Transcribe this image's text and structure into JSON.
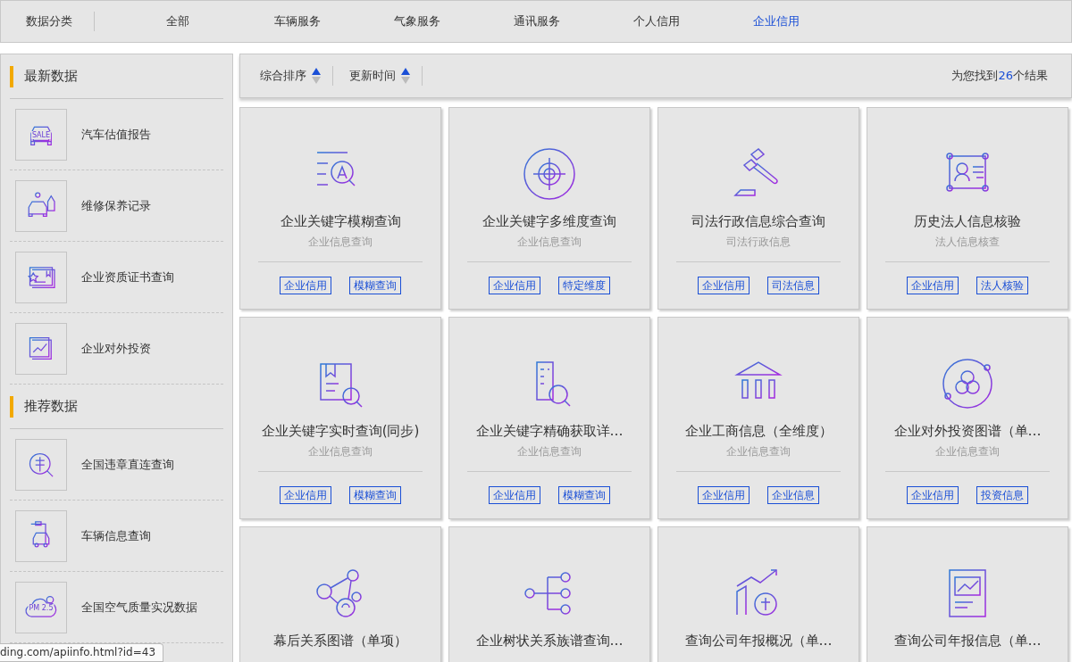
{
  "nav": {
    "label": "数据分类",
    "tabs": [
      {
        "label": "全部",
        "selected": false
      },
      {
        "label": "车辆服务",
        "selected": false
      },
      {
        "label": "气象服务",
        "selected": false
      },
      {
        "label": "通讯服务",
        "selected": false
      },
      {
        "label": "个人信用",
        "selected": false
      },
      {
        "label": "企业信用",
        "selected": true
      }
    ]
  },
  "sidebar": {
    "sections": [
      {
        "title": "最新数据",
        "items": [
          {
            "label": "汽车估值报告",
            "icon_text": "SALE"
          },
          {
            "label": "维修保养记录"
          },
          {
            "label": "企业资质证书查询"
          },
          {
            "label": "企业对外投资"
          }
        ]
      },
      {
        "title": "推荐数据",
        "items": [
          {
            "label": "全国违章直连查询"
          },
          {
            "label": "车辆信息查询"
          },
          {
            "label": "全国空气质量实况数据",
            "icon_text": "PM 2.5"
          }
        ]
      }
    ]
  },
  "toolbar": {
    "sorts": [
      "综合排序",
      "更新时间"
    ],
    "result_prefix": "为您找到",
    "result_count": "26",
    "result_suffix": "个结果"
  },
  "cards": [
    {
      "title": "企业关键字模糊查询",
      "subtitle": "企业信息查询",
      "tags": [
        "企业信用",
        "模糊查询"
      ]
    },
    {
      "title": "企业关键字多维度查询",
      "subtitle": "企业信息查询",
      "tags": [
        "企业信用",
        "特定维度"
      ]
    },
    {
      "title": "司法行政信息综合查询",
      "subtitle": "司法行政信息",
      "tags": [
        "企业信用",
        "司法信息"
      ]
    },
    {
      "title": "历史法人信息核验",
      "subtitle": "法人信息核查",
      "tags": [
        "企业信用",
        "法人核验"
      ]
    },
    {
      "title": "企业关键字实时查询(同步)",
      "subtitle": "企业信息查询",
      "tags": [
        "企业信用",
        "模糊查询"
      ]
    },
    {
      "title": "企业关键字精确获取详…",
      "subtitle": "企业信息查询",
      "tags": [
        "企业信用",
        "模糊查询"
      ]
    },
    {
      "title": "企业工商信息（全维度）",
      "subtitle": "企业信息查询",
      "tags": [
        "企业信用",
        "企业信息"
      ]
    },
    {
      "title": "企业对外投资图谱（单…",
      "subtitle": "企业信息查询",
      "tags": [
        "企业信用",
        "投资信息"
      ]
    },
    {
      "title": "幕后关系图谱（单项）"
    },
    {
      "title": "企业树状关系族谱查询…"
    },
    {
      "title": "查询公司年报概况（单…"
    },
    {
      "title": "查询公司年报信息（单…"
    }
  ],
  "status_bar": {
    "url": "ding.com/apiinfo.html?id=43"
  }
}
